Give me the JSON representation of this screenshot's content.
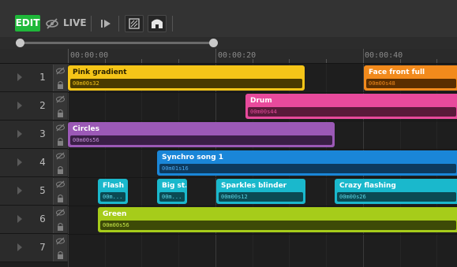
{
  "toolbar": {
    "edit_label": "EDIT",
    "live_label": "LIVE",
    "edit_color": "#1fb83a"
  },
  "scrubber": {
    "start_fraction": 0.0,
    "end_fraction": 1.0
  },
  "ruler": {
    "labels": [
      "00:00:00",
      "00:00:20",
      "00:00:40"
    ]
  },
  "tracks": [
    {
      "number": "1"
    },
    {
      "number": "2"
    },
    {
      "number": "3"
    },
    {
      "number": "4"
    },
    {
      "number": "5"
    },
    {
      "number": "6"
    },
    {
      "number": "7"
    }
  ],
  "clips": {
    "pink_gradient": {
      "name": "Pink gradient",
      "duration": "00m00s32",
      "color": "#f5c518"
    },
    "face_front_full": {
      "name": "Face front full",
      "duration": "00m00s48",
      "color": "#f28a1c"
    },
    "drum": {
      "name": "Drum",
      "duration": "00m00s44",
      "color": "#e84a9c"
    },
    "circles": {
      "name": "Circles",
      "duration": "00m00s56",
      "color": "#9b59b6"
    },
    "synchro_song": {
      "name": "Synchro song 1",
      "duration": "00m01s16",
      "color": "#1a86d8"
    },
    "flash": {
      "name": "Flash ...",
      "duration": "00m...",
      "color": "#1ab8cc"
    },
    "big_st": {
      "name": "Big st...",
      "duration": "00m...",
      "color": "#1ab8cc"
    },
    "sparkles_blinder": {
      "name": "Sparkles blinder",
      "duration": "00m00s12",
      "color": "#1ab8cc"
    },
    "crazy_flashing": {
      "name": "Crazy flashing",
      "duration": "00m00s26",
      "color": "#1ab8cc"
    },
    "green": {
      "name": "Green",
      "duration": "00m00s56",
      "color": "#a6cc1a"
    }
  }
}
